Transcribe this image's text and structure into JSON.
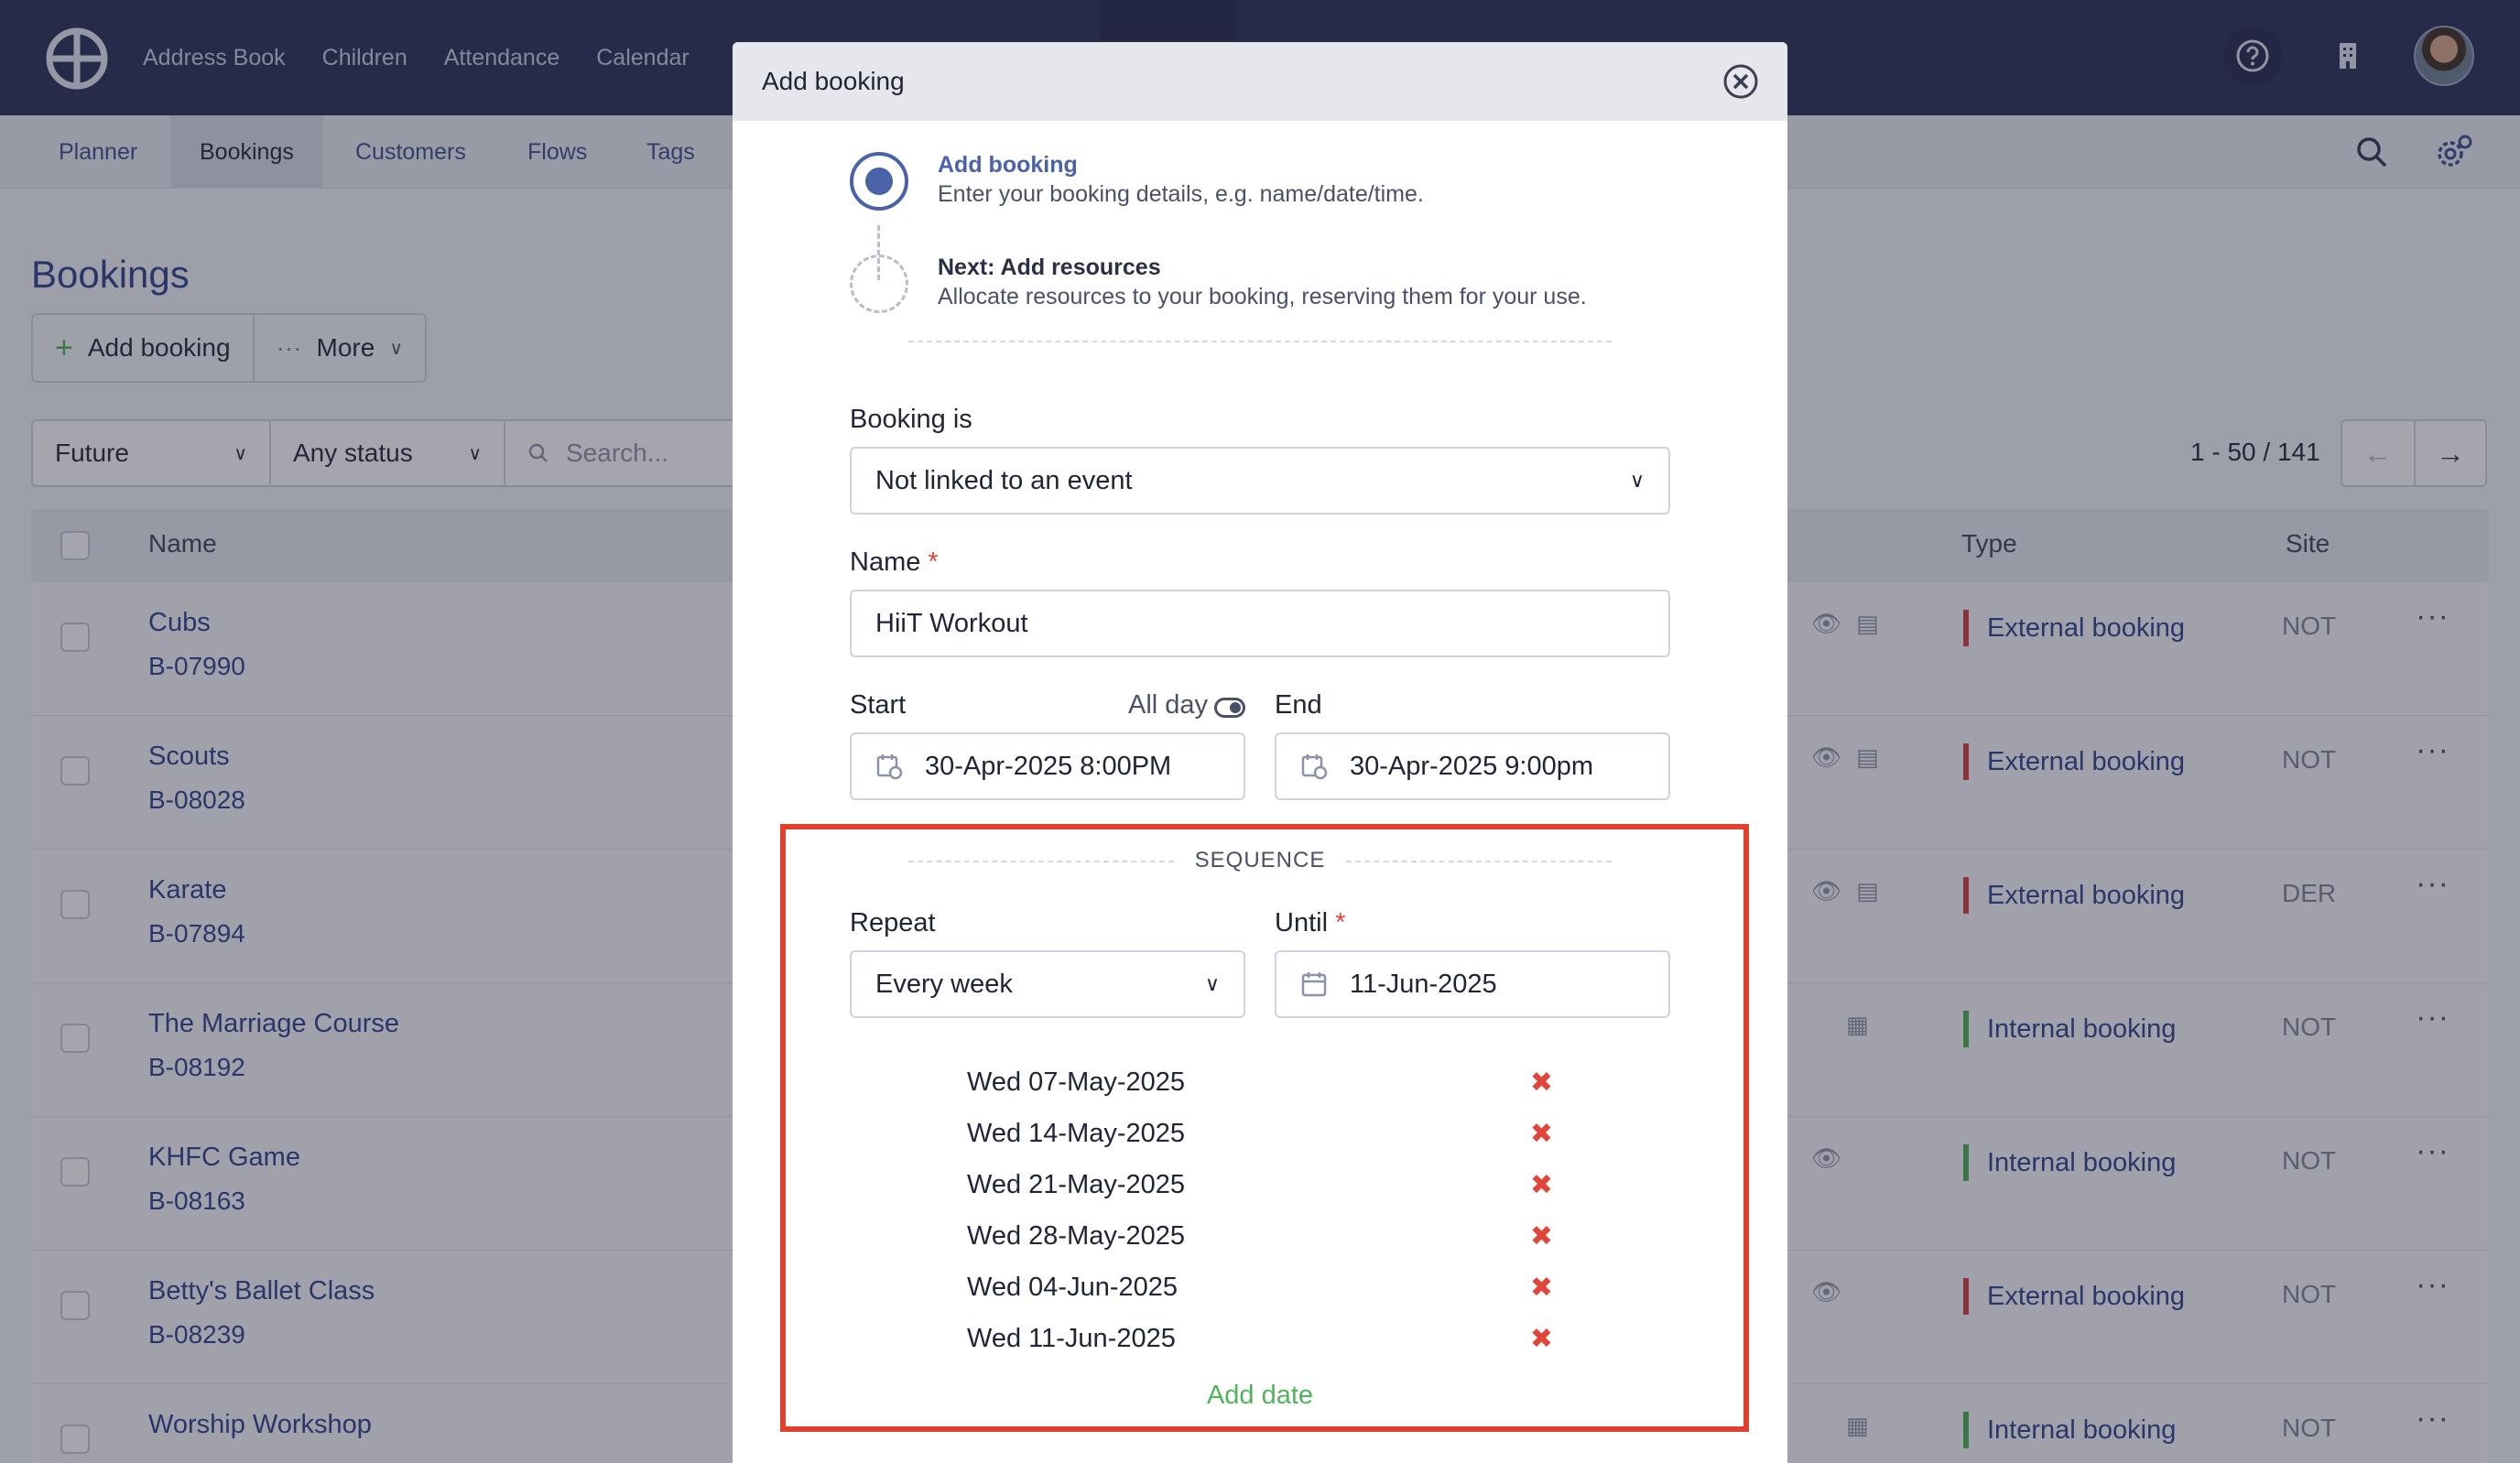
{
  "topnav": {
    "items": [
      "Address Book",
      "Children",
      "Attendance",
      "Calendar"
    ]
  },
  "subnav": {
    "tabs": [
      "Planner",
      "Bookings",
      "Customers",
      "Flows",
      "Tags"
    ],
    "active": "Bookings"
  },
  "page": {
    "title": "Bookings",
    "add_booking_label": "Add booking",
    "more_label": "More",
    "filter_time": "Future",
    "filter_status": "Any status",
    "search_placeholder": "Search...",
    "pager_text": "1 - 50 / 141"
  },
  "table": {
    "headers": {
      "name": "Name",
      "type": "Type",
      "site": "Site"
    },
    "rows": [
      {
        "name": "Cubs",
        "code": "B-07990",
        "type": "External booking",
        "site": "NOT"
      },
      {
        "name": "Scouts",
        "code": "B-08028",
        "type": "External booking",
        "site": "NOT"
      },
      {
        "name": "Karate",
        "code": "B-07894",
        "type": "External booking",
        "site": "DER"
      },
      {
        "name": "The Marriage Course",
        "code": "B-08192",
        "type": "Internal booking",
        "site": "NOT"
      },
      {
        "name": "KHFC Game",
        "code": "B-08163",
        "type": "Internal booking",
        "site": "NOT"
      },
      {
        "name": "Betty's Ballet Class",
        "code": "B-08239",
        "type": "External booking",
        "site": "NOT"
      },
      {
        "name": "Worship Workshop",
        "code": "",
        "type": "Internal booking",
        "site": "NOT"
      }
    ]
  },
  "modal": {
    "title": "Add booking",
    "steps": [
      {
        "title": "Add booking",
        "desc": "Enter your booking details, e.g. name/date/time."
      },
      {
        "title": "Next: Add resources",
        "desc": "Allocate resources to your booking, reserving them for your use."
      }
    ],
    "booking_is_label": "Booking is",
    "booking_is_value": "Not linked to an event",
    "name_label": "Name",
    "name_value": "HiiT Workout",
    "start_label": "Start",
    "all_day_label": "All day",
    "end_label": "End",
    "start_value": "30-Apr-2025 8:00PM",
    "end_value": "30-Apr-2025 9:00pm",
    "sequence_label": "SEQUENCE",
    "repeat_label": "Repeat",
    "repeat_value": "Every week",
    "until_label": "Until",
    "until_value": "11-Jun-2025",
    "dates": [
      "Wed 07-May-2025",
      "Wed 14-May-2025",
      "Wed 21-May-2025",
      "Wed 28-May-2025",
      "Wed 04-Jun-2025",
      "Wed 11-Jun-2025"
    ],
    "add_date_label": "Add date"
  },
  "colors": {
    "accent": "#4a63a8",
    "highlight_border": "#e0412f",
    "external": "#d43c3c",
    "internal": "#4caf50"
  }
}
